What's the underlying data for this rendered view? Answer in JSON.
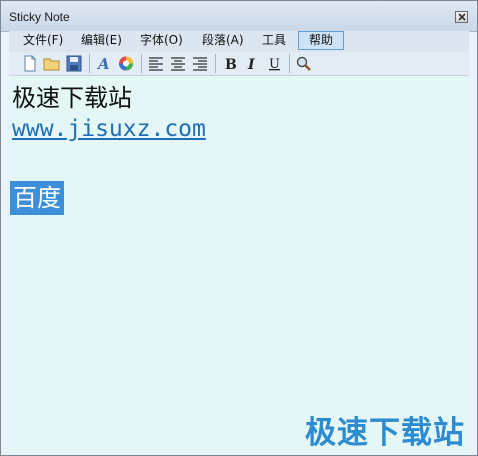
{
  "window": {
    "title": "Sticky Note"
  },
  "menu": {
    "items": [
      "文件(F)",
      "编辑(E)",
      "字体(O)",
      "段落(A)",
      "工具",
      "帮助"
    ]
  },
  "toolbar": {
    "icons": [
      "new-document-icon",
      "open-folder-icon",
      "save-icon",
      "font-icon",
      "color-wheel-icon",
      "align-left-icon",
      "align-center-icon",
      "align-right-icon",
      "bold-icon",
      "italic-icon",
      "underline-icon",
      "find-icon"
    ]
  },
  "editor": {
    "line1": "极速下载站",
    "line2": "www.jisuxz.com",
    "line3": "百度"
  },
  "watermark": "极速下载站",
  "colors": {
    "editor_bg": "#e4f6f6",
    "link": "#1e6fb4",
    "selection": "#3c8fd8",
    "watermark": "#2d8bd2"
  }
}
